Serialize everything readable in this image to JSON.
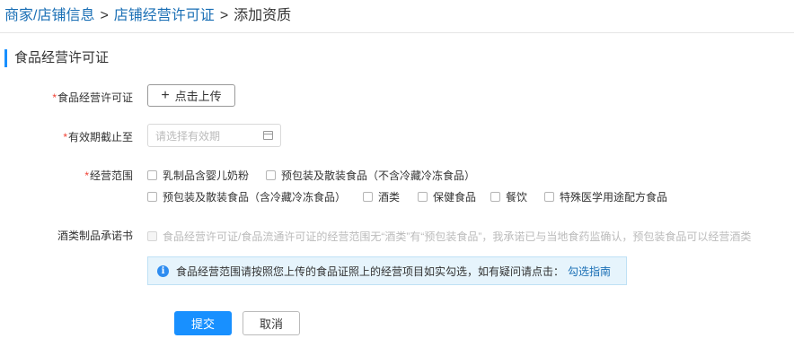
{
  "breadcrumb": {
    "items": [
      "商家/店铺信息",
      "店铺经营许可证",
      "添加资质"
    ],
    "separator": ">"
  },
  "section": {
    "title": "食品经营许可证"
  },
  "form": {
    "license": {
      "label": "食品经营许可证",
      "upload_button": "点击上传"
    },
    "expiry": {
      "label": "有效期截止至",
      "placeholder": "请选择有效期"
    },
    "scope": {
      "label": "经营范围",
      "options": [
        "乳制品含婴儿奶粉",
        "预包装及散装食品（不含冷藏冷冻食品）",
        "预包装及散装食品（含冷藏冷冻食品）",
        "酒类",
        "保健食品",
        "餐饮",
        "特殊医学用途配方食品"
      ]
    },
    "liquor_commitment": {
      "label": "酒类制品承诺书",
      "text": "食品经营许可证/食品流通许可证的经营范围无“酒类”有“预包装食品”，我承诺已与当地食药监确认，预包装食品可以经营酒类"
    },
    "required_mark": "*"
  },
  "notice": {
    "text": "食品经营范围请按照您上传的食品证照上的经营项目如实勾选，如有疑问请点击：",
    "link": "勾选指南"
  },
  "actions": {
    "submit": "提交",
    "cancel": "取消"
  },
  "colors": {
    "accent": "#1890ff",
    "link": "#1a6fb5",
    "required": "#f04134",
    "notice_bg": "#e6f4fc"
  }
}
